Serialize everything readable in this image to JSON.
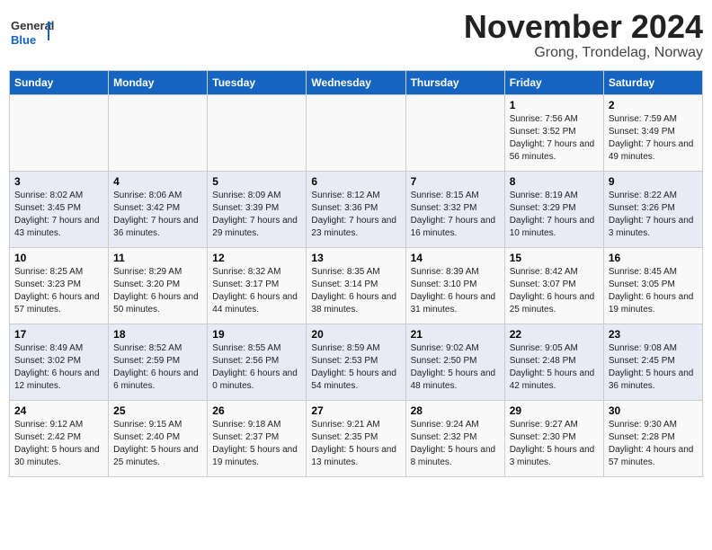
{
  "logo": {
    "text_general": "General",
    "text_blue": "Blue"
  },
  "title": "November 2024",
  "subtitle": "Grong, Trondelag, Norway",
  "days_of_week": [
    "Sunday",
    "Monday",
    "Tuesday",
    "Wednesday",
    "Thursday",
    "Friday",
    "Saturday"
  ],
  "weeks": [
    [
      {
        "day": "",
        "info": ""
      },
      {
        "day": "",
        "info": ""
      },
      {
        "day": "",
        "info": ""
      },
      {
        "day": "",
        "info": ""
      },
      {
        "day": "",
        "info": ""
      },
      {
        "day": "1",
        "info": "Sunrise: 7:56 AM\nSunset: 3:52 PM\nDaylight: 7 hours and 56 minutes."
      },
      {
        "day": "2",
        "info": "Sunrise: 7:59 AM\nSunset: 3:49 PM\nDaylight: 7 hours and 49 minutes."
      }
    ],
    [
      {
        "day": "3",
        "info": "Sunrise: 8:02 AM\nSunset: 3:45 PM\nDaylight: 7 hours and 43 minutes."
      },
      {
        "day": "4",
        "info": "Sunrise: 8:06 AM\nSunset: 3:42 PM\nDaylight: 7 hours and 36 minutes."
      },
      {
        "day": "5",
        "info": "Sunrise: 8:09 AM\nSunset: 3:39 PM\nDaylight: 7 hours and 29 minutes."
      },
      {
        "day": "6",
        "info": "Sunrise: 8:12 AM\nSunset: 3:36 PM\nDaylight: 7 hours and 23 minutes."
      },
      {
        "day": "7",
        "info": "Sunrise: 8:15 AM\nSunset: 3:32 PM\nDaylight: 7 hours and 16 minutes."
      },
      {
        "day": "8",
        "info": "Sunrise: 8:19 AM\nSunset: 3:29 PM\nDaylight: 7 hours and 10 minutes."
      },
      {
        "day": "9",
        "info": "Sunrise: 8:22 AM\nSunset: 3:26 PM\nDaylight: 7 hours and 3 minutes."
      }
    ],
    [
      {
        "day": "10",
        "info": "Sunrise: 8:25 AM\nSunset: 3:23 PM\nDaylight: 6 hours and 57 minutes."
      },
      {
        "day": "11",
        "info": "Sunrise: 8:29 AM\nSunset: 3:20 PM\nDaylight: 6 hours and 50 minutes."
      },
      {
        "day": "12",
        "info": "Sunrise: 8:32 AM\nSunset: 3:17 PM\nDaylight: 6 hours and 44 minutes."
      },
      {
        "day": "13",
        "info": "Sunrise: 8:35 AM\nSunset: 3:14 PM\nDaylight: 6 hours and 38 minutes."
      },
      {
        "day": "14",
        "info": "Sunrise: 8:39 AM\nSunset: 3:10 PM\nDaylight: 6 hours and 31 minutes."
      },
      {
        "day": "15",
        "info": "Sunrise: 8:42 AM\nSunset: 3:07 PM\nDaylight: 6 hours and 25 minutes."
      },
      {
        "day": "16",
        "info": "Sunrise: 8:45 AM\nSunset: 3:05 PM\nDaylight: 6 hours and 19 minutes."
      }
    ],
    [
      {
        "day": "17",
        "info": "Sunrise: 8:49 AM\nSunset: 3:02 PM\nDaylight: 6 hours and 12 minutes."
      },
      {
        "day": "18",
        "info": "Sunrise: 8:52 AM\nSunset: 2:59 PM\nDaylight: 6 hours and 6 minutes."
      },
      {
        "day": "19",
        "info": "Sunrise: 8:55 AM\nSunset: 2:56 PM\nDaylight: 6 hours and 0 minutes."
      },
      {
        "day": "20",
        "info": "Sunrise: 8:59 AM\nSunset: 2:53 PM\nDaylight: 5 hours and 54 minutes."
      },
      {
        "day": "21",
        "info": "Sunrise: 9:02 AM\nSunset: 2:50 PM\nDaylight: 5 hours and 48 minutes."
      },
      {
        "day": "22",
        "info": "Sunrise: 9:05 AM\nSunset: 2:48 PM\nDaylight: 5 hours and 42 minutes."
      },
      {
        "day": "23",
        "info": "Sunrise: 9:08 AM\nSunset: 2:45 PM\nDaylight: 5 hours and 36 minutes."
      }
    ],
    [
      {
        "day": "24",
        "info": "Sunrise: 9:12 AM\nSunset: 2:42 PM\nDaylight: 5 hours and 30 minutes."
      },
      {
        "day": "25",
        "info": "Sunrise: 9:15 AM\nSunset: 2:40 PM\nDaylight: 5 hours and 25 minutes."
      },
      {
        "day": "26",
        "info": "Sunrise: 9:18 AM\nSunset: 2:37 PM\nDaylight: 5 hours and 19 minutes."
      },
      {
        "day": "27",
        "info": "Sunrise: 9:21 AM\nSunset: 2:35 PM\nDaylight: 5 hours and 13 minutes."
      },
      {
        "day": "28",
        "info": "Sunrise: 9:24 AM\nSunset: 2:32 PM\nDaylight: 5 hours and 8 minutes."
      },
      {
        "day": "29",
        "info": "Sunrise: 9:27 AM\nSunset: 2:30 PM\nDaylight: 5 hours and 3 minutes."
      },
      {
        "day": "30",
        "info": "Sunrise: 9:30 AM\nSunset: 2:28 PM\nDaylight: 4 hours and 57 minutes."
      }
    ]
  ]
}
